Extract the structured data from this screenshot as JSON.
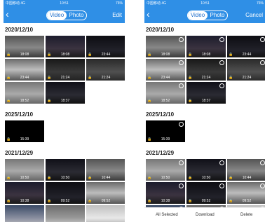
{
  "left_phone": {
    "status": {
      "carrier": "中国移动 4G",
      "time": "10:51",
      "battery": "76%"
    },
    "tabs": [
      {
        "label": "Video",
        "active": true
      },
      {
        "label": "Photo",
        "active": false
      }
    ],
    "action_label": "Edit",
    "groups": [
      {
        "date": "2020/12/10",
        "thumbs": [
          "18:08",
          "18:08",
          "23:44",
          "23:44",
          "21:24",
          "21:24",
          "18:52",
          "18:37"
        ]
      },
      {
        "date": "2025/12/10",
        "thumbs": [
          "15:39"
        ]
      },
      {
        "date": "2021/12/29",
        "thumbs": [
          "10:50",
          "10:50",
          "10:44",
          "10:38",
          "09:52",
          "09:52",
          "",
          "",
          ""
        ]
      }
    ]
  },
  "right_phone": {
    "status": {
      "carrier": "中国移动 4G",
      "time": "10:51",
      "battery": "76%"
    },
    "tabs": [
      {
        "label": "Video",
        "active": true
      },
      {
        "label": "Photo",
        "active": false
      }
    ],
    "action_label": "Cancel",
    "groups": [
      {
        "date": "2020/12/10",
        "thumbs": [
          "18:08",
          "18:08",
          "23:44",
          "23:44",
          "21:24",
          "21:24",
          "18:52",
          "18:37"
        ]
      },
      {
        "date": "2025/12/10",
        "thumbs": [
          "15:39"
        ]
      },
      {
        "date": "2021/12/29",
        "thumbs": [
          "10:50",
          "10:50",
          "10:44",
          "10:38",
          "09:52",
          "09:52",
          "",
          "",
          ""
        ]
      }
    ],
    "bottom_bar": {
      "all_selected": "All Selected",
      "download": "Download",
      "delete": "Delete"
    }
  },
  "colors": {
    "header": "#2f8fe6",
    "accent_text": "#1f6fcc"
  },
  "icons": {
    "back": "chevron-left-icon",
    "lock": "lock-icon",
    "select": "select-circle-icon"
  }
}
